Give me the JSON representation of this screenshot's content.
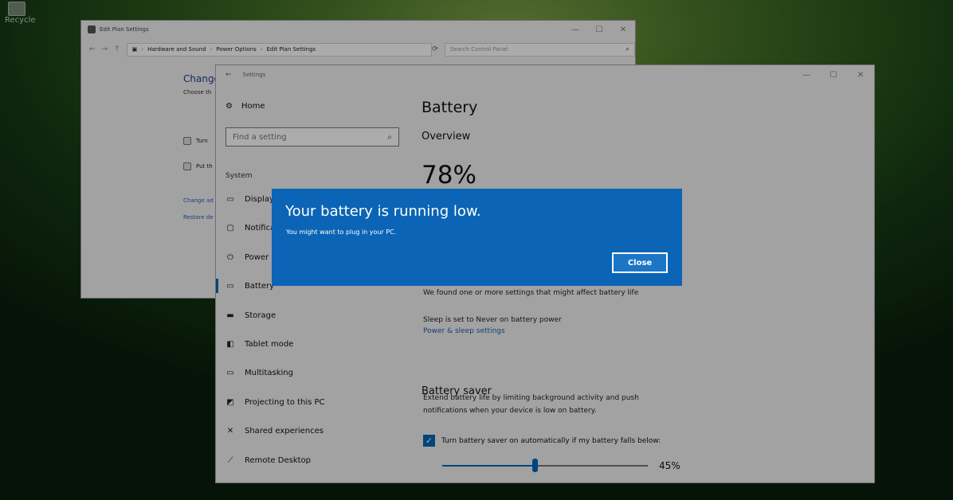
{
  "desktop": {
    "icon_label": "Recycle"
  },
  "control_panel": {
    "window_title": "Edit Plan Settings",
    "window_buttons": [
      "—",
      "☐",
      "✕"
    ],
    "breadcrumb": [
      "Hardware and Sound",
      "Power Options",
      "Edit Plan Settings"
    ],
    "search_placeholder": "Search Control Panel",
    "heading": "Change",
    "subheading": "Choose th",
    "rows": [
      "Turn",
      "Put th"
    ],
    "links": [
      "Change ad",
      "Restore de"
    ]
  },
  "settings": {
    "window_title": "Settings",
    "window_buttons": [
      "—",
      "☐",
      "✕"
    ],
    "nav": {
      "home": "Home",
      "find_placeholder": "Find a setting",
      "section": "System",
      "items": [
        {
          "label": "Display",
          "icon": "display-icon"
        },
        {
          "label": "Notifications",
          "icon": "notifications-icon"
        },
        {
          "label": "Power",
          "icon": "power-icon"
        },
        {
          "label": "Battery",
          "icon": "battery-icon"
        },
        {
          "label": "Storage",
          "icon": "storage-icon"
        },
        {
          "label": "Tablet mode",
          "icon": "tablet-mode-icon"
        },
        {
          "label": "Multitasking",
          "icon": "multitasking-icon"
        },
        {
          "label": "Projecting to this PC",
          "icon": "projecting-icon"
        },
        {
          "label": "Shared experiences",
          "icon": "shared-experiences-icon"
        },
        {
          "label": "Remote Desktop",
          "icon": "remote-desktop-icon"
        }
      ],
      "selected": "Battery"
    },
    "main": {
      "title": "Battery",
      "overview": "Overview",
      "percent": "78%",
      "found_text": "We found one or more settings that might affect battery life",
      "sleep_text": "Sleep is set to Never on battery power",
      "power_sleep_link": "Power & sleep settings",
      "saver_heading": "Battery saver",
      "saver_desc_1": "Extend battery life by limiting background activity and push",
      "saver_desc_2": "notifications when your device is low on battery.",
      "checkbox_label": "Turn battery saver on automatically if my battery falls below:",
      "checkbox_checked": true,
      "slider_value": 0.45,
      "slider_label": "45%"
    }
  },
  "toast": {
    "title": "Your battery is running low.",
    "message": "You might want to plug in your PC.",
    "close_label": "Close"
  },
  "colors": {
    "accent": "#0067b8",
    "toast_bg": "#0b64b5"
  }
}
